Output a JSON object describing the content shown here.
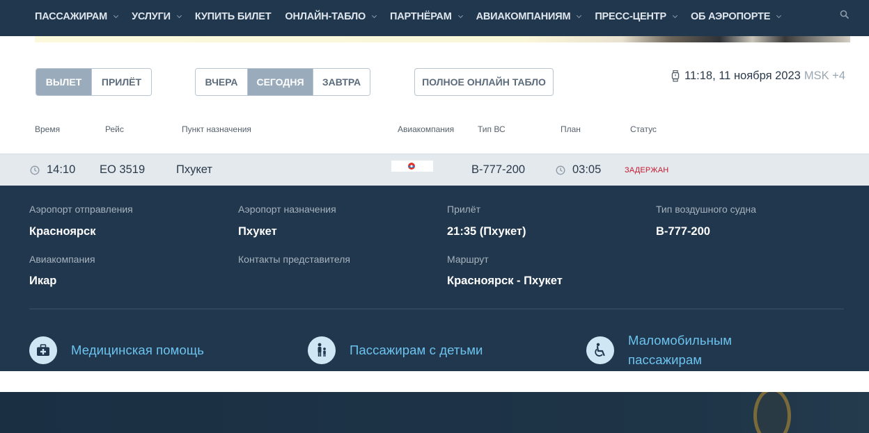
{
  "nav": {
    "items": [
      {
        "label": "ПАССАЖИРАМ",
        "dropdown": true
      },
      {
        "label": "УСЛУГИ",
        "dropdown": true
      },
      {
        "label": "КУПИТЬ БИЛЕТ",
        "dropdown": false
      },
      {
        "label": "ОНЛАЙН-ТАБЛО",
        "dropdown": true
      },
      {
        "label": "ПАРТНЁРАМ",
        "dropdown": true
      },
      {
        "label": "АВИАКОМПАНИЯМ",
        "dropdown": true
      },
      {
        "label": "ПРЕСС-ЦЕНТР",
        "dropdown": true
      },
      {
        "label": "ОБ АЭРОПОРТЕ",
        "dropdown": true
      }
    ],
    "search_icon": "search-icon"
  },
  "direction": {
    "departure": "ВЫЛЕТ",
    "arrival": "ПРИЛЁТ",
    "active": "departure"
  },
  "day": {
    "yesterday": "ВЧЕРА",
    "today": "СЕГОДНЯ",
    "tomorrow": "ЗАВТРА",
    "active": "today"
  },
  "full_board_label": "ПОЛНОЕ ОНЛАЙН ТАБЛО",
  "clock": {
    "time": "11:18, 11 ноября 2023",
    "timezone": "MSK +4"
  },
  "columns": {
    "time": "Время",
    "flight": "Рейс",
    "destination": "Пункт назначения",
    "airline": "Авиакомпания",
    "aircraft": "Тип ВС",
    "plan": "План",
    "status": "Статус"
  },
  "flight": {
    "time": "14:10",
    "number": "EO 3519",
    "destination": "Пхукет",
    "aircraft": "B-777-200",
    "plan": "03:05",
    "status": "ЗАДЕРЖАН"
  },
  "details": {
    "departure_airport_label": "Аэропорт отправления",
    "departure_airport": "Красноярск",
    "arrival_airport_label": "Аэропорт назначения",
    "arrival_airport": "Пхукет",
    "arrival_label": "Прилёт",
    "arrival": "21:35 (Пхукет)",
    "aircraft_label": "Тип воздушного судна",
    "aircraft": "B-777-200",
    "airline_label": "Авиакомпания",
    "airline": "Икар",
    "contacts_label": "Контакты представителя",
    "route_label": "Маршрут",
    "route": "Красноярск - Пхукет"
  },
  "services": {
    "medical": "Медицинская помощь",
    "children": "Пассажирам с детьми",
    "reduced_mobility_line1": "Маломобильным",
    "reduced_mobility_line2": "пассажирам"
  },
  "colors": {
    "nav_bg": "#21374d",
    "active_button": "#9aabbb",
    "status_delayed": "#c4182e",
    "service_link": "#6cc3ef"
  }
}
